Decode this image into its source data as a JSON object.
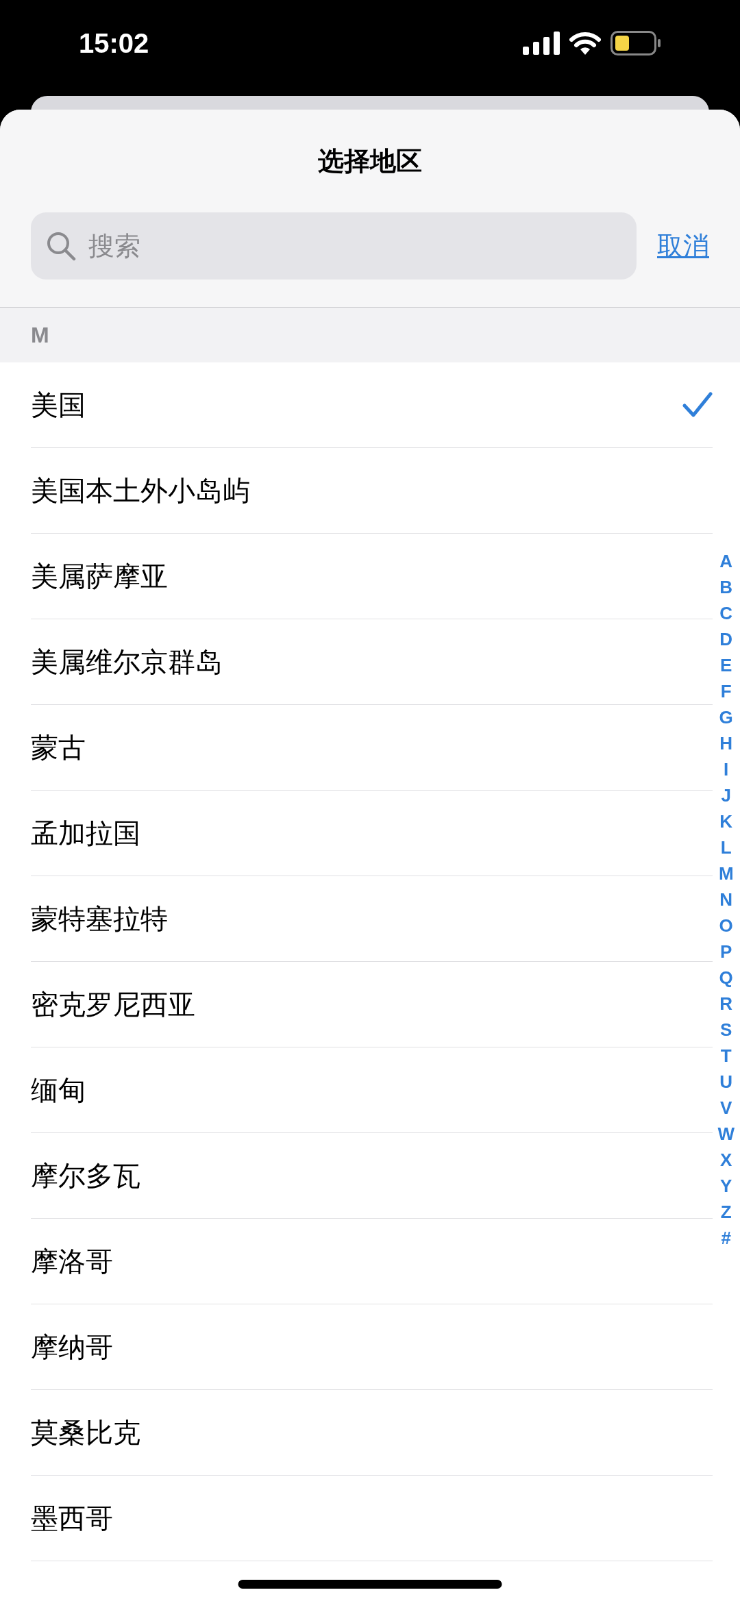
{
  "status_bar": {
    "time": "15:02"
  },
  "sheet": {
    "title": "选择地区",
    "search": {
      "placeholder": "搜索"
    },
    "cancel": "取消"
  },
  "section": {
    "header": "M"
  },
  "rows": [
    {
      "label": "美国",
      "selected": true
    },
    {
      "label": "美国本土外小岛屿",
      "selected": false
    },
    {
      "label": "美属萨摩亚",
      "selected": false
    },
    {
      "label": "美属维尔京群岛",
      "selected": false
    },
    {
      "label": "蒙古",
      "selected": false
    },
    {
      "label": "孟加拉国",
      "selected": false
    },
    {
      "label": "蒙特塞拉特",
      "selected": false
    },
    {
      "label": "密克罗尼西亚",
      "selected": false
    },
    {
      "label": "缅甸",
      "selected": false
    },
    {
      "label": "摩尔多瓦",
      "selected": false
    },
    {
      "label": "摩洛哥",
      "selected": false
    },
    {
      "label": "摩纳哥",
      "selected": false
    },
    {
      "label": "莫桑比克",
      "selected": false
    },
    {
      "label": "墨西哥",
      "selected": false
    }
  ],
  "index": [
    "A",
    "B",
    "C",
    "D",
    "E",
    "F",
    "G",
    "H",
    "I",
    "J",
    "K",
    "L",
    "M",
    "N",
    "O",
    "P",
    "Q",
    "R",
    "S",
    "T",
    "U",
    "V",
    "W",
    "X",
    "Y",
    "Z",
    "#"
  ]
}
